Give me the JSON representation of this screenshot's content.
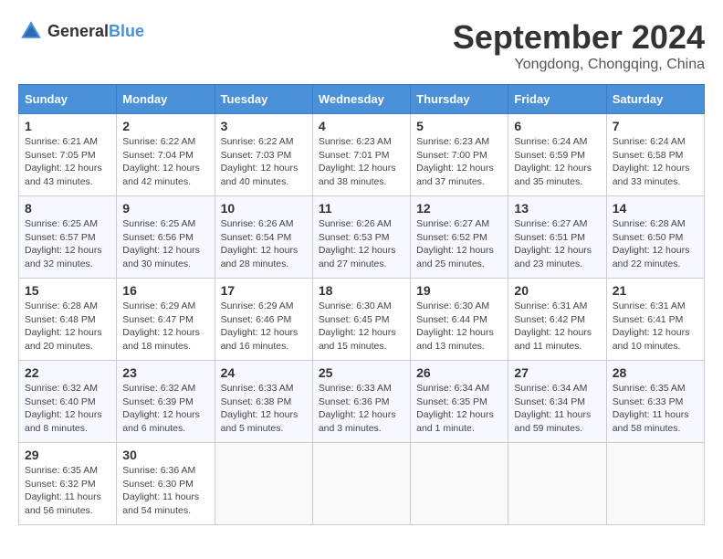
{
  "logo": {
    "text_general": "General",
    "text_blue": "Blue"
  },
  "title": "September 2024",
  "location": "Yongdong, Chongqing, China",
  "headers": [
    "Sunday",
    "Monday",
    "Tuesday",
    "Wednesday",
    "Thursday",
    "Friday",
    "Saturday"
  ],
  "weeks": [
    [
      {
        "day": "1",
        "content": "Sunrise: 6:21 AM\nSunset: 7:05 PM\nDaylight: 12 hours\nand 43 minutes."
      },
      {
        "day": "2",
        "content": "Sunrise: 6:22 AM\nSunset: 7:04 PM\nDaylight: 12 hours\nand 42 minutes."
      },
      {
        "day": "3",
        "content": "Sunrise: 6:22 AM\nSunset: 7:03 PM\nDaylight: 12 hours\nand 40 minutes."
      },
      {
        "day": "4",
        "content": "Sunrise: 6:23 AM\nSunset: 7:01 PM\nDaylight: 12 hours\nand 38 minutes."
      },
      {
        "day": "5",
        "content": "Sunrise: 6:23 AM\nSunset: 7:00 PM\nDaylight: 12 hours\nand 37 minutes."
      },
      {
        "day": "6",
        "content": "Sunrise: 6:24 AM\nSunset: 6:59 PM\nDaylight: 12 hours\nand 35 minutes."
      },
      {
        "day": "7",
        "content": "Sunrise: 6:24 AM\nSunset: 6:58 PM\nDaylight: 12 hours\nand 33 minutes."
      }
    ],
    [
      {
        "day": "8",
        "content": "Sunrise: 6:25 AM\nSunset: 6:57 PM\nDaylight: 12 hours\nand 32 minutes."
      },
      {
        "day": "9",
        "content": "Sunrise: 6:25 AM\nSunset: 6:56 PM\nDaylight: 12 hours\nand 30 minutes."
      },
      {
        "day": "10",
        "content": "Sunrise: 6:26 AM\nSunset: 6:54 PM\nDaylight: 12 hours\nand 28 minutes."
      },
      {
        "day": "11",
        "content": "Sunrise: 6:26 AM\nSunset: 6:53 PM\nDaylight: 12 hours\nand 27 minutes."
      },
      {
        "day": "12",
        "content": "Sunrise: 6:27 AM\nSunset: 6:52 PM\nDaylight: 12 hours\nand 25 minutes."
      },
      {
        "day": "13",
        "content": "Sunrise: 6:27 AM\nSunset: 6:51 PM\nDaylight: 12 hours\nand 23 minutes."
      },
      {
        "day": "14",
        "content": "Sunrise: 6:28 AM\nSunset: 6:50 PM\nDaylight: 12 hours\nand 22 minutes."
      }
    ],
    [
      {
        "day": "15",
        "content": "Sunrise: 6:28 AM\nSunset: 6:48 PM\nDaylight: 12 hours\nand 20 minutes."
      },
      {
        "day": "16",
        "content": "Sunrise: 6:29 AM\nSunset: 6:47 PM\nDaylight: 12 hours\nand 18 minutes."
      },
      {
        "day": "17",
        "content": "Sunrise: 6:29 AM\nSunset: 6:46 PM\nDaylight: 12 hours\nand 16 minutes."
      },
      {
        "day": "18",
        "content": "Sunrise: 6:30 AM\nSunset: 6:45 PM\nDaylight: 12 hours\nand 15 minutes."
      },
      {
        "day": "19",
        "content": "Sunrise: 6:30 AM\nSunset: 6:44 PM\nDaylight: 12 hours\nand 13 minutes."
      },
      {
        "day": "20",
        "content": "Sunrise: 6:31 AM\nSunset: 6:42 PM\nDaylight: 12 hours\nand 11 minutes."
      },
      {
        "day": "21",
        "content": "Sunrise: 6:31 AM\nSunset: 6:41 PM\nDaylight: 12 hours\nand 10 minutes."
      }
    ],
    [
      {
        "day": "22",
        "content": "Sunrise: 6:32 AM\nSunset: 6:40 PM\nDaylight: 12 hours\nand 8 minutes."
      },
      {
        "day": "23",
        "content": "Sunrise: 6:32 AM\nSunset: 6:39 PM\nDaylight: 12 hours\nand 6 minutes."
      },
      {
        "day": "24",
        "content": "Sunrise: 6:33 AM\nSunset: 6:38 PM\nDaylight: 12 hours\nand 5 minutes."
      },
      {
        "day": "25",
        "content": "Sunrise: 6:33 AM\nSunset: 6:36 PM\nDaylight: 12 hours\nand 3 minutes."
      },
      {
        "day": "26",
        "content": "Sunrise: 6:34 AM\nSunset: 6:35 PM\nDaylight: 12 hours\nand 1 minute."
      },
      {
        "day": "27",
        "content": "Sunrise: 6:34 AM\nSunset: 6:34 PM\nDaylight: 11 hours\nand 59 minutes."
      },
      {
        "day": "28",
        "content": "Sunrise: 6:35 AM\nSunset: 6:33 PM\nDaylight: 11 hours\nand 58 minutes."
      }
    ],
    [
      {
        "day": "29",
        "content": "Sunrise: 6:35 AM\nSunset: 6:32 PM\nDaylight: 11 hours\nand 56 minutes."
      },
      {
        "day": "30",
        "content": "Sunrise: 6:36 AM\nSunset: 6:30 PM\nDaylight: 11 hours\nand 54 minutes."
      },
      {
        "day": "",
        "content": ""
      },
      {
        "day": "",
        "content": ""
      },
      {
        "day": "",
        "content": ""
      },
      {
        "day": "",
        "content": ""
      },
      {
        "day": "",
        "content": ""
      }
    ]
  ]
}
